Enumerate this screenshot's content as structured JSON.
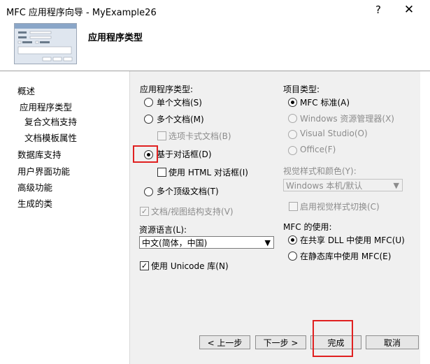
{
  "window": {
    "title": "MFC 应用程序向导 - MyExample26",
    "help_glyph": "?",
    "close_glyph": "✕"
  },
  "header": {
    "title": "应用程序类型"
  },
  "nav": {
    "items": [
      "概述",
      "应用程序类型",
      "复合文档支持",
      "文档模板属性",
      "数据库支持",
      "用户界面功能",
      "高级功能",
      "生成的类"
    ]
  },
  "app_type": {
    "label": "应用程序类型:",
    "single": "单个文档(S)",
    "multi": "多个文档(M)",
    "tabbed": "选项卡式文档(B)",
    "dialog": "基于对话框(D)",
    "html_dialog": "使用 HTML 对话框(I)",
    "multi_top": "多个顶级文档(T)",
    "docview": "文档/视图结构支持(V)"
  },
  "resource_lang": {
    "label": "资源语言(L):",
    "value": "中文(简体，中国)"
  },
  "unicode": {
    "label": "使用 Unicode 库(N)",
    "checked": true
  },
  "project_type": {
    "label": "项目类型:",
    "options": [
      "MFC 标准(A)",
      "Windows 资源管理器(X)",
      "Visual Studio(O)",
      "Office(F)"
    ]
  },
  "visual_style": {
    "label": "视觉样式和颜色(Y):",
    "value": "Windows 本机/默认",
    "toggle": "启用视觉样式切换(C)"
  },
  "mfc_use": {
    "label": "MFC 的使用:",
    "shared": "在共享 DLL 中使用 MFC(U)",
    "static": "在静态库中使用 MFC(E)"
  },
  "buttons": {
    "prev": "< 上一步",
    "next": "下一步 >",
    "finish": "完成",
    "cancel": "取消"
  }
}
